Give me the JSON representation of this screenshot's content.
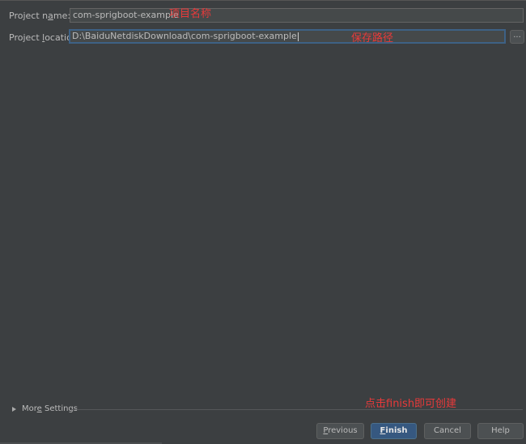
{
  "form": {
    "project_name": {
      "label_before": "Project n",
      "label_mnemonic": "a",
      "label_after": "me:",
      "value": "com-sprigboot-example"
    },
    "project_location": {
      "label_before": "Project ",
      "label_mnemonic": "l",
      "label_after": "ocation:",
      "value": "D:\\BaiduNetdiskDownload\\com-sprigboot-example"
    },
    "browse_label": "..."
  },
  "annotations": {
    "name_note": "项目名称",
    "location_note": "保存路径",
    "finish_note": "点击finish即可创建"
  },
  "more_settings": {
    "label_before": "Mor",
    "label_mnemonic": "e",
    "label_after": " Settings"
  },
  "buttons": {
    "previous": {
      "mnemonic": "P",
      "rest": "revious"
    },
    "finish": {
      "mnemonic": "F",
      "rest": "inish"
    },
    "cancel": "Cancel",
    "help": "Help"
  },
  "colors": {
    "background": "#3c3f41",
    "field_background": "#45494a",
    "focus_border": "#3d6185",
    "default_button": "#365880",
    "annotation": "#e83a3a"
  },
  "icons": {
    "more_settings": "triangle-right-icon"
  }
}
